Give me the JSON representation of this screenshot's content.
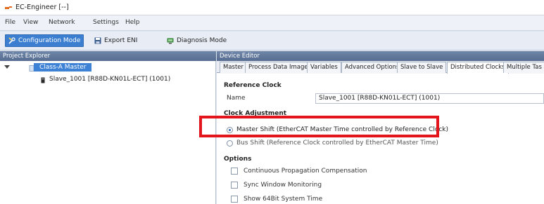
{
  "window": {
    "title": "EC-Engineer [--]"
  },
  "menu": [
    "File",
    "View",
    "Network",
    "Settings",
    "Help"
  ],
  "toolbar": {
    "configuration_mode": "Configuration Mode",
    "export_eni": "Export ENI",
    "diagnosis_mode": "Diagnosis Mode"
  },
  "project_explorer": {
    "title": "Project Explorer",
    "master": "Class-A Master",
    "slave": "Slave_1001 [R88D-KN01L-ECT] (1001)"
  },
  "device_editor": {
    "title": "Device Editor",
    "tabs": [
      "Master",
      "Process Data Image",
      "Variables",
      "Advanced Options",
      "Slave to Slave",
      "Distributed Clocks",
      "Multiple Tas"
    ],
    "active_tab": "Distributed Clocks",
    "reference_clock": {
      "heading": "Reference Clock",
      "name_label": "Name",
      "name_value": "Slave_1001 [R88D-KN01L-ECT] (1001)"
    },
    "clock_adjustment": {
      "heading": "Clock Adjustment",
      "options": [
        {
          "label": "Master Shift (EtherCAT Master Time controlled by Reference Clock)",
          "selected": true
        },
        {
          "label": "Bus Shift (Reference Clock controlled by EtherCAT Master Time)",
          "selected": false
        }
      ]
    },
    "options": {
      "heading": "Options",
      "items": [
        {
          "label": "Continuous Propagation Compensation",
          "checked": false
        },
        {
          "label": "Sync Window Monitoring",
          "checked": false
        },
        {
          "label": "Show 64Bit System Time",
          "checked": false
        }
      ]
    }
  },
  "colors": {
    "accent": "#3c7fd1",
    "highlight": "#e3141b",
    "panel_header": "#5e7498"
  }
}
